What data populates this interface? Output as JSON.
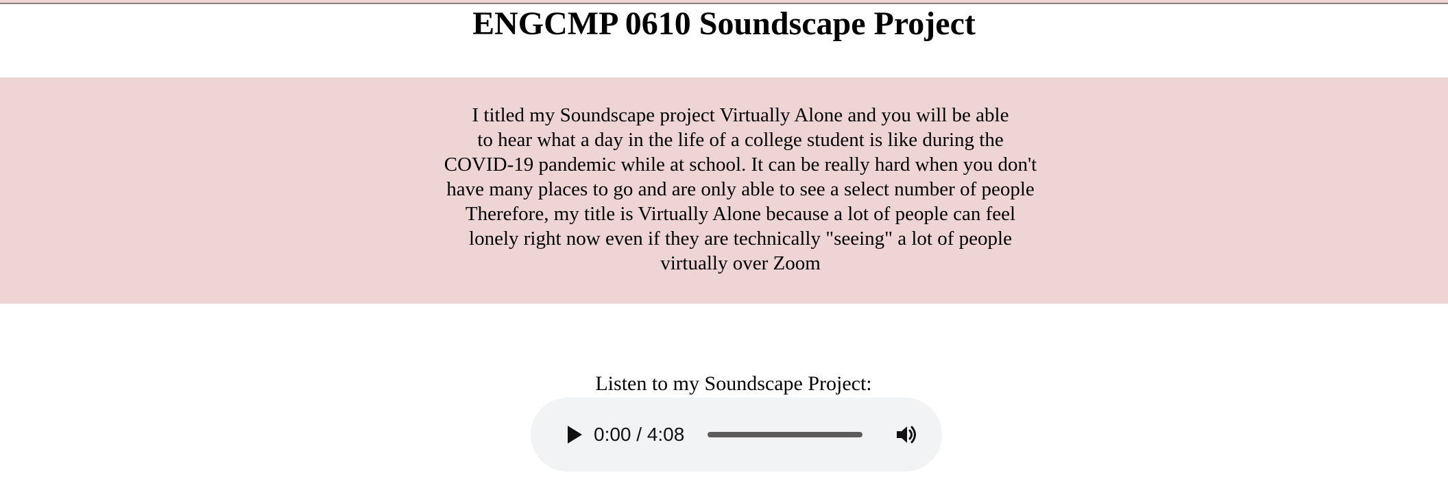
{
  "page": {
    "title": "ENGCMP 0610 Soundscape Project",
    "background_color": "#ffffff",
    "accent_band_color": "#efd4d6"
  },
  "intro": {
    "text": "I titled my Soundscape project Virtually Alone and you will be able\nto hear what a day in the life of a college student is like during the\nCOVID-19 pandemic while at school. It can be really hard when you don't\nhave many places to go and are only able to see a select number of people\nTherefore, my title is Virtually Alone because a lot of people can feel\nlonely right now even if they are technically \"seeing\" a lot of people\nvirtually over Zoom"
  },
  "audio": {
    "label": "Listen to my Soundscape Project:",
    "time_display": "0:00 / 4:08",
    "progress_fraction": 0,
    "play_icon": "play-icon",
    "volume_icon": "volume-icon",
    "player_color": "#f1f3f4"
  }
}
